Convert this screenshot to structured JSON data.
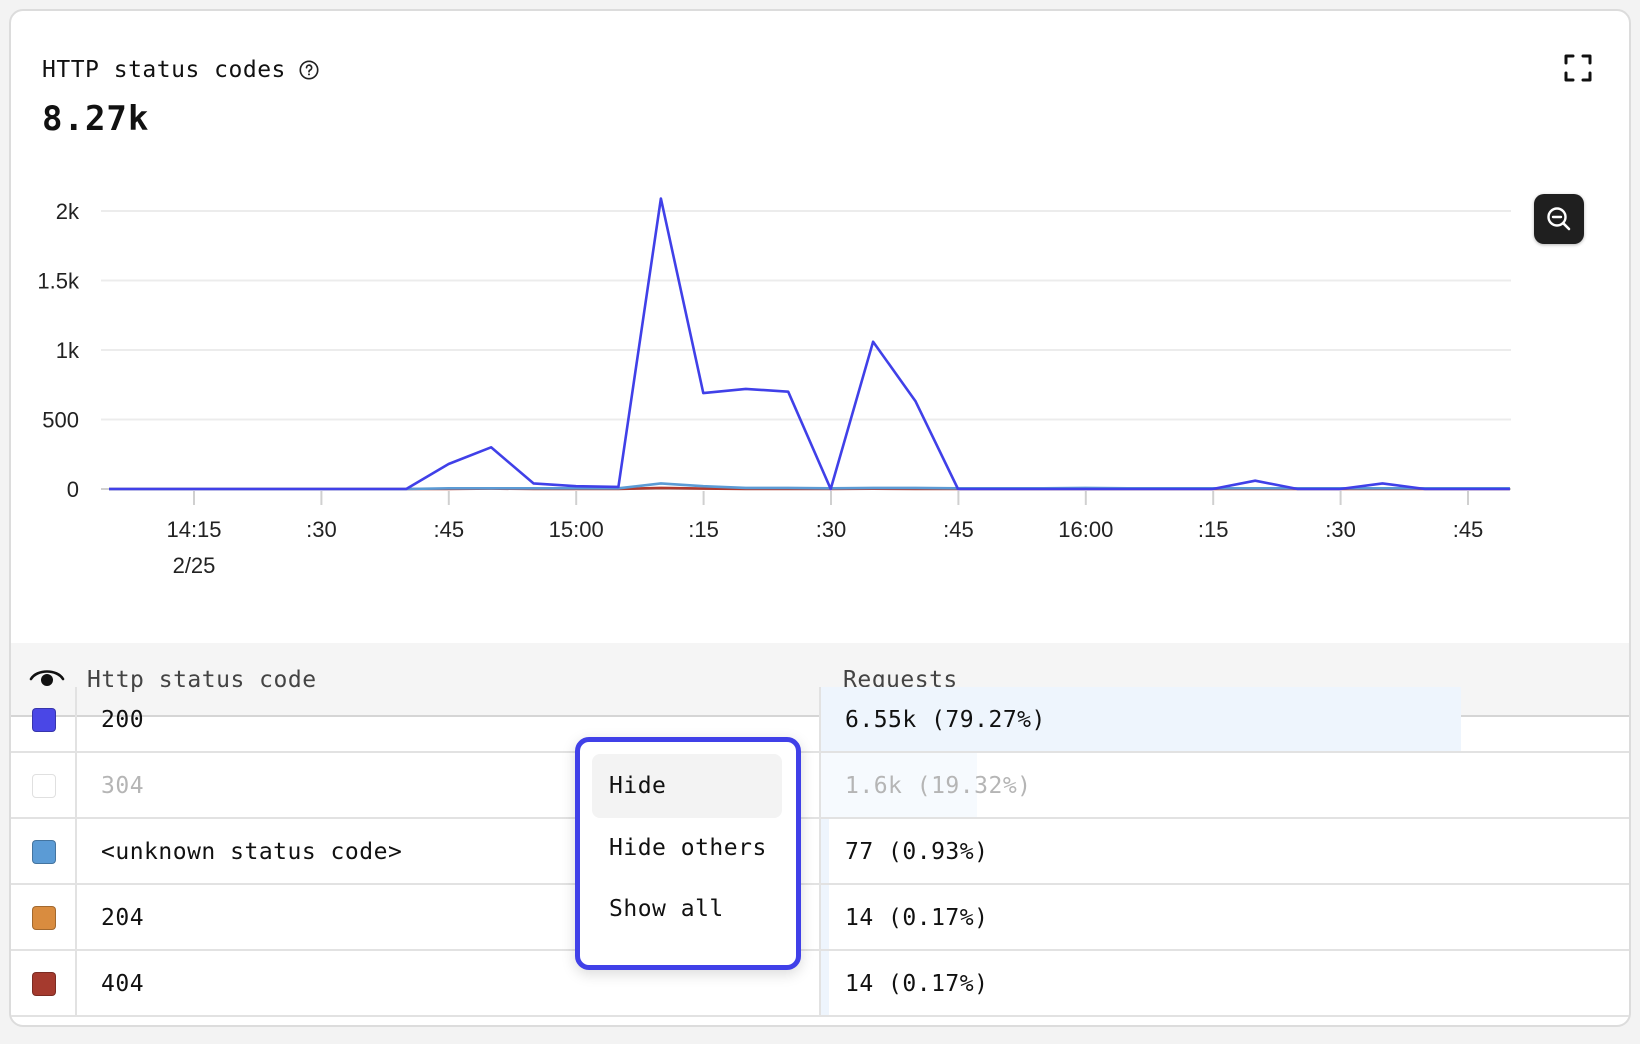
{
  "header": {
    "title": "HTTP status codes",
    "total": "8.27k"
  },
  "icons": {
    "help": "help-circle-icon",
    "expand": "expand-icon",
    "zoom": "zoom-out-icon",
    "visibility": "eye-icon"
  },
  "chart_data": {
    "type": "line",
    "y_ticks": [
      "2k",
      "1.5k",
      "1k",
      "500",
      "0"
    ],
    "x_ticks": [
      "14:15",
      ":30",
      ":45",
      "15:00",
      ":15",
      ":30",
      ":45",
      "16:00",
      ":15",
      ":30",
      ":45"
    ],
    "x_sublabel": "2/25",
    "ylim": [
      0,
      2000
    ],
    "series": [
      {
        "name": "200",
        "color": "#4040e8",
        "values": [
          0,
          0,
          0,
          0,
          0,
          0,
          0,
          0,
          180,
          300,
          40,
          20,
          15,
          2090,
          690,
          720,
          700,
          0,
          1060,
          630,
          0,
          0,
          0,
          0,
          0,
          0,
          0,
          60,
          0,
          0,
          40,
          0,
          0,
          0
        ]
      },
      {
        "name": "<unknown status code>",
        "color": "#5b9bd5",
        "values": [
          0,
          0,
          0,
          0,
          0,
          0,
          0,
          0,
          5,
          5,
          5,
          5,
          5,
          40,
          20,
          8,
          8,
          5,
          8,
          8,
          5,
          5,
          5,
          8,
          5,
          5,
          5,
          5,
          5,
          5,
          5,
          5,
          5,
          5
        ]
      },
      {
        "name": "404",
        "color": "#b03a2e",
        "values": [
          0,
          0,
          0,
          0,
          0,
          0,
          0,
          0,
          0,
          3,
          0,
          0,
          0,
          8,
          3,
          0,
          0,
          0,
          2,
          0,
          0,
          0,
          0,
          0,
          0,
          0,
          0,
          0,
          0,
          0,
          0,
          0,
          0,
          0
        ]
      }
    ]
  },
  "table": {
    "col_code": "Http status code",
    "col_requests": "Requests",
    "rows": [
      {
        "code": "200",
        "requests": "6.55k (79.27%)",
        "color": "#4a47e6",
        "share": 79.27,
        "muted": false
      },
      {
        "code": "304",
        "requests": "1.6k (19.32%)",
        "color": "#ffffff",
        "share": 19.32,
        "muted": true
      },
      {
        "code": "<unknown status code>",
        "requests": "77 (0.93%)",
        "color": "#5b9bd5",
        "share": 0.93,
        "muted": false
      },
      {
        "code": "204",
        "requests": "14 (0.17%)",
        "color": "#d98c3f",
        "share": 0.17,
        "muted": false
      },
      {
        "code": "404",
        "requests": "14 (0.17%)",
        "color": "#a53a2e",
        "share": 0.17,
        "muted": false
      }
    ]
  },
  "context_menu": {
    "items": [
      "Hide",
      "Hide others",
      "Show all"
    ]
  }
}
